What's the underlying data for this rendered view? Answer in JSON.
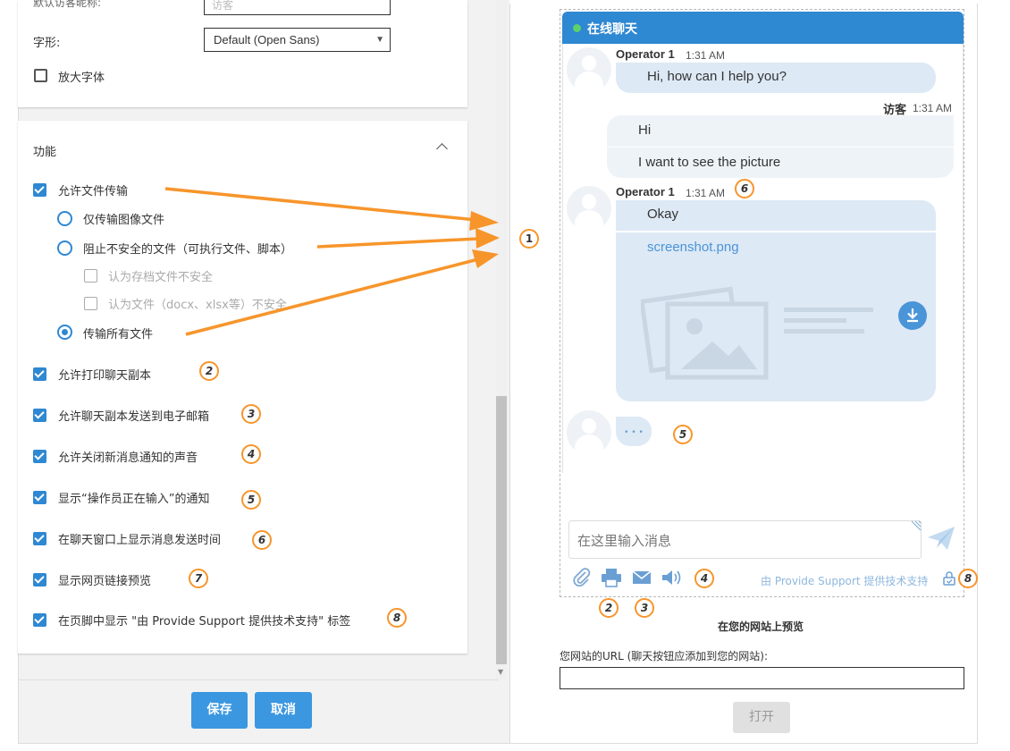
{
  "settings": {
    "visitor_name_label": "默认访客昵称:",
    "visitor_name_placeholder": "访客",
    "font_label": "字形:",
    "font_value": "Default (Open Sans)",
    "large_font_label": "放大字体"
  },
  "features": {
    "title": "功能",
    "file_transfer": "允许文件传输",
    "images_only": "仅传输图像文件",
    "block_unsafe": "阻止不安全的文件（可执行文件、脚本）",
    "archives_unsafe": "认为存档文件不安全",
    "docs_unsafe": "认为文件（docx、xlsx等）不安全",
    "all_files": "传输所有文件",
    "print_transcript": "允许打印聊天副本",
    "email_transcript": "允许聊天副本发送到电子邮箱",
    "mute_sound": "允许关闭新消息通知的声音",
    "typing_notice": "显示“操作员正在输入”的通知",
    "show_timestamps": "在聊天窗口上显示消息发送时间",
    "link_preview": "显示网页链接预览",
    "powered_label": "在页脚中显示 \"由 Provide Support 提供技术支持\" 标签"
  },
  "badges": [
    "1",
    "2",
    "3",
    "4",
    "5",
    "6",
    "7",
    "8"
  ],
  "buttons": {
    "save": "保存",
    "cancel": "取消",
    "open": "打开"
  },
  "chat": {
    "title": "在线聊天",
    "operator_name": "Operator 1",
    "time": "1:31 AM",
    "visitor_name": "访客",
    "msg1": "Hi, how can I help you?",
    "msg2": "Hi",
    "msg3": "I want to see the picture",
    "msg4": "Okay",
    "file_name": "screenshot.png",
    "typing": "• • •",
    "input_placeholder": "在这里输入消息",
    "powered_by": "由 Provide Support 提供技术支持"
  },
  "preview": {
    "title": "在您的网站上预览",
    "url_label": "您网站的URL (聊天按钮应添加到您的网站):"
  },
  "colors": {
    "accent": "#2f88d2",
    "badge": "#f7952b",
    "online": "#5cd36a"
  }
}
